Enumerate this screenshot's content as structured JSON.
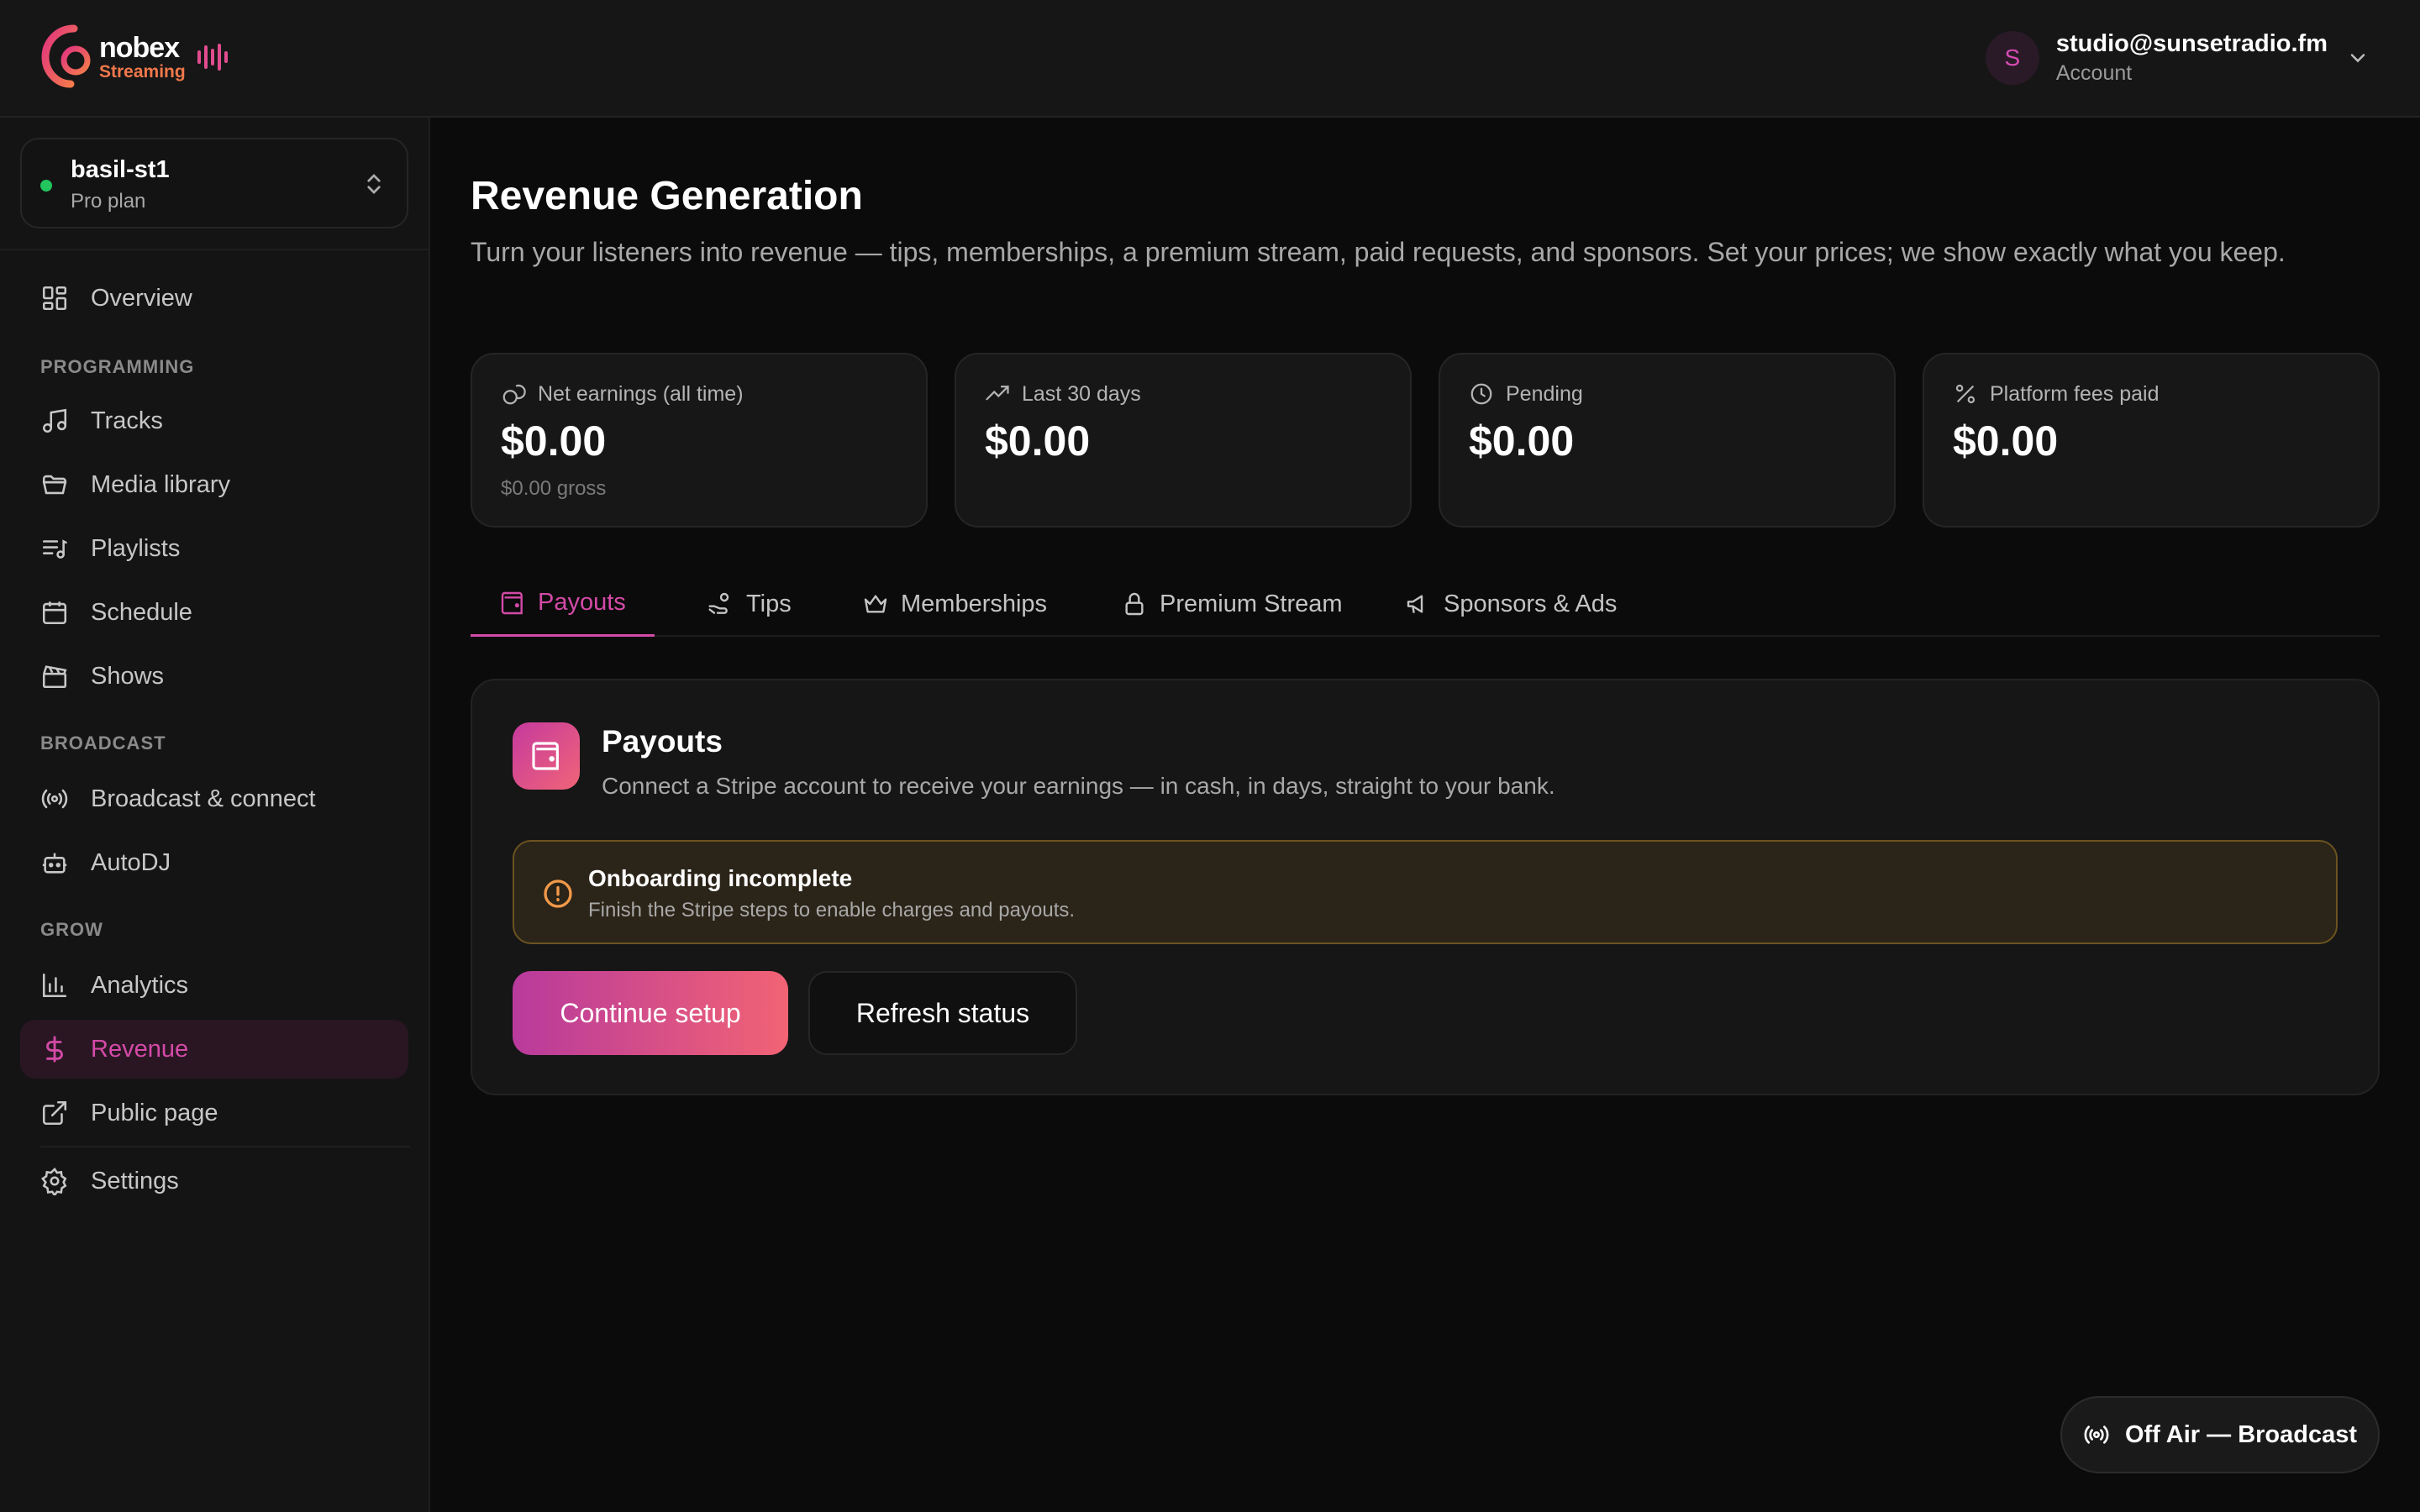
{
  "brand": {
    "name": "nobex",
    "sub": "Streaming"
  },
  "account": {
    "initial": "S",
    "email": "studio@sunsetradio.fm",
    "label": "Account"
  },
  "station": {
    "name": "basil-st1",
    "plan": "Pro plan",
    "status_color": "#22c55e"
  },
  "sidebar": {
    "overview": "Overview",
    "groups": {
      "programming": "PROGRAMMING",
      "broadcast": "BROADCAST",
      "grow": "GROW"
    },
    "items": {
      "tracks": "Tracks",
      "media_library": "Media library",
      "playlists": "Playlists",
      "schedule": "Schedule",
      "shows": "Shows",
      "broadcast_connect": "Broadcast & connect",
      "autodj": "AutoDJ",
      "analytics": "Analytics",
      "revenue": "Revenue",
      "public_page": "Public page",
      "settings": "Settings"
    },
    "active": "revenue"
  },
  "page": {
    "title": "Revenue Generation",
    "description": "Turn your listeners into revenue — tips, memberships, a premium stream, paid requests, and sponsors. Set your prices; we show exactly what you keep."
  },
  "stats": [
    {
      "label": "Net earnings (all time)",
      "value": "$0.00",
      "sub": "$0.00 gross",
      "icon": "coins-icon"
    },
    {
      "label": "Last 30 days",
      "value": "$0.00",
      "icon": "trending-up-icon"
    },
    {
      "label": "Pending",
      "value": "$0.00",
      "icon": "clock-icon"
    },
    {
      "label": "Platform fees paid",
      "value": "$0.00",
      "icon": "percent-icon"
    }
  ],
  "tabs": [
    {
      "label": "Payouts",
      "icon": "wallet-icon",
      "active": true
    },
    {
      "label": "Tips",
      "icon": "hand-coins-icon"
    },
    {
      "label": "Memberships",
      "icon": "crown-icon"
    },
    {
      "label": "Premium Stream",
      "icon": "lock-icon"
    },
    {
      "label": "Sponsors & Ads",
      "icon": "megaphone-icon"
    }
  ],
  "payouts": {
    "title": "Payouts",
    "description": "Connect a Stripe account to receive your earnings — in cash, in days, straight to your bank.",
    "alert": {
      "title": "Onboarding incomplete",
      "description": "Finish the Stripe steps to enable charges and payouts."
    },
    "primary_button": "Continue setup",
    "secondary_button": "Refresh status"
  },
  "broadcast_status": "Off Air — Broadcast",
  "colors": {
    "accent": "#d44aa7",
    "gradient_start": "#b83a9c",
    "gradient_end": "#f26374",
    "warning": "#f2994a"
  }
}
